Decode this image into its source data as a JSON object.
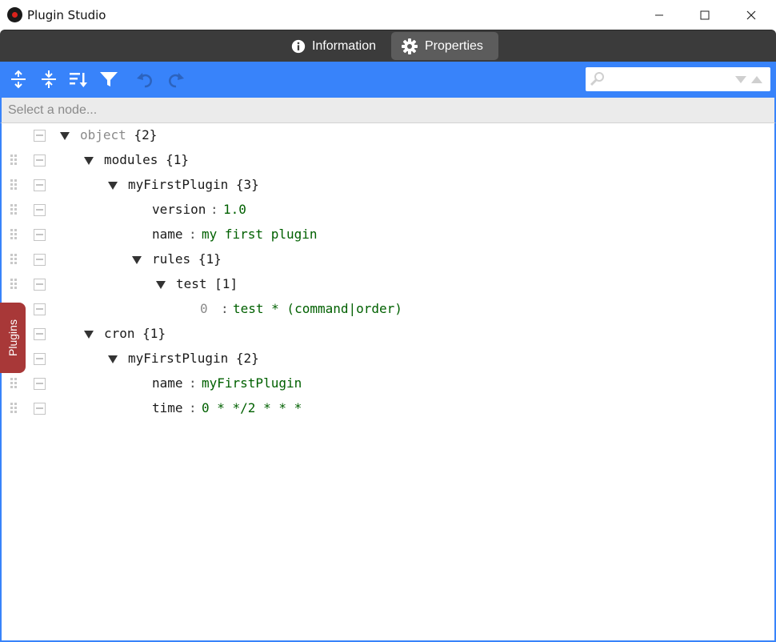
{
  "window": {
    "title": "Plugin Studio",
    "icon": "app-logo-icon"
  },
  "tabs": [
    {
      "label": "Information",
      "icon": "info-icon",
      "active": false
    },
    {
      "label": "Properties",
      "icon": "gear-icon",
      "active": true
    }
  ],
  "toolbar": {
    "buttons": [
      "expand-all-icon",
      "collapse-all-icon",
      "sort-icon",
      "filter-icon",
      "undo-icon",
      "redo-icon"
    ],
    "accent": "#3883fa",
    "search": {
      "value": "",
      "placeholder": ""
    }
  },
  "navbar": {
    "placeholder": "Select a node..."
  },
  "side_panel": {
    "label": "Plugins",
    "color": "#a83838"
  },
  "tree": {
    "root": {
      "field": "object",
      "count": "{2}"
    },
    "modules": {
      "field": "modules",
      "count": "{1}"
    },
    "my_first_plugin": {
      "field": "myFirstPlugin",
      "count": "{3}"
    },
    "version": {
      "field": "version",
      "value": "1.0"
    },
    "name": {
      "field": "name",
      "value": "my first plugin"
    },
    "rules": {
      "field": "rules",
      "count": "{1}"
    },
    "test": {
      "field": "test",
      "count": "[1]"
    },
    "test_item": {
      "index": "0",
      "value": "test * (command|order)"
    },
    "cron": {
      "field": "cron",
      "count": "{1}"
    },
    "cron_plugin": {
      "field": "myFirstPlugin",
      "count": "{2}"
    },
    "cron_name": {
      "field": "name",
      "value": "myFirstPlugin"
    },
    "cron_time": {
      "field": "time",
      "value": "0 * */2 * * *"
    },
    "colon": ":"
  }
}
